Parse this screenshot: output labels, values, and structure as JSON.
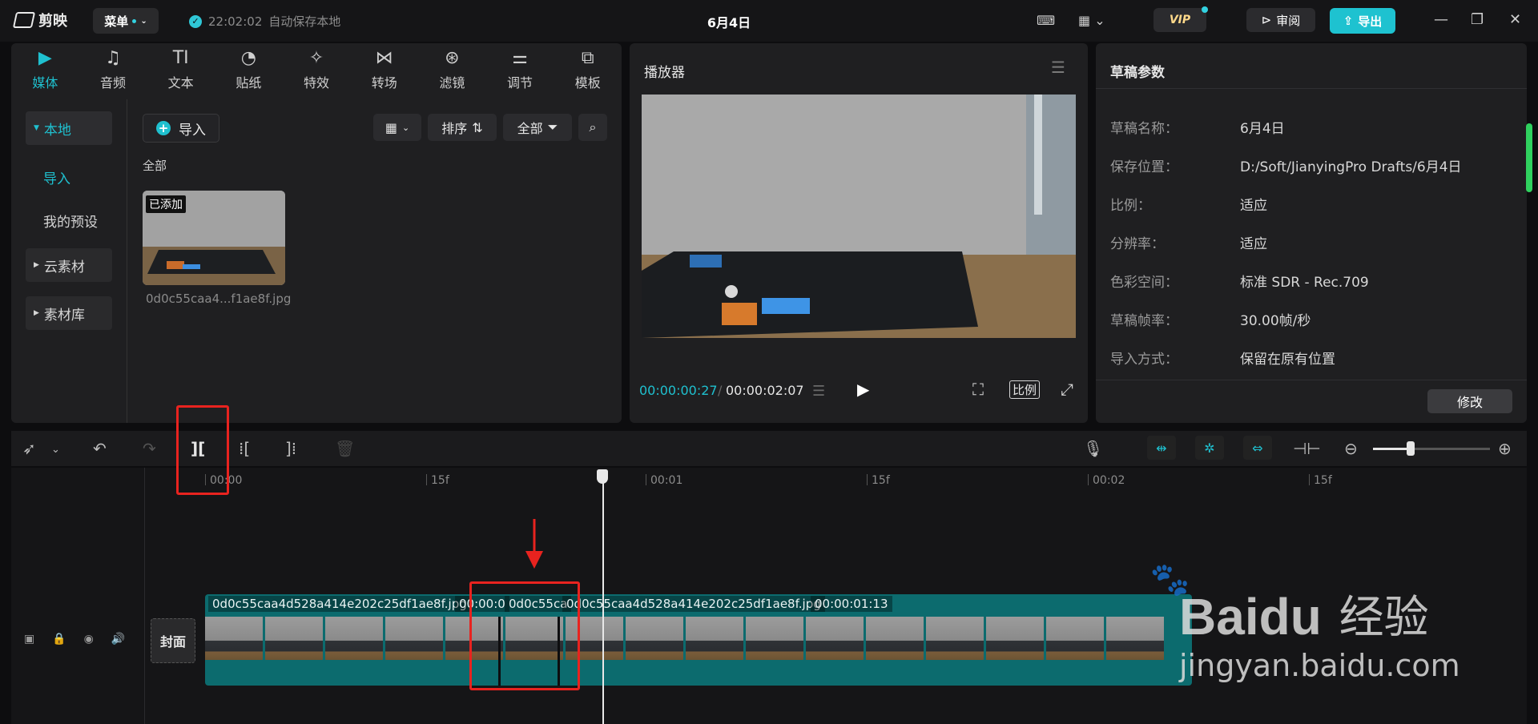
{
  "titlebar": {
    "app_name": "剪映",
    "menu_label": "菜单",
    "autosave_time": "22:02:02",
    "autosave_text": "自动保存本地",
    "doc_title": "6月4日",
    "vip_label": "VIP",
    "review_label": "审阅",
    "export_label": "导出"
  },
  "media_tabs": [
    {
      "label": "媒体",
      "icon": "▶"
    },
    {
      "label": "音频",
      "icon": "♫"
    },
    {
      "label": "文本",
      "icon": "TI"
    },
    {
      "label": "贴纸",
      "icon": "◔"
    },
    {
      "label": "特效",
      "icon": "✧"
    },
    {
      "label": "转场",
      "icon": "⋈"
    },
    {
      "label": "滤镜",
      "icon": "⊛"
    },
    {
      "label": "调节",
      "icon": "⚌"
    },
    {
      "label": "模板",
      "icon": "⧉"
    }
  ],
  "sidebar": {
    "local": "本地",
    "import": "导入",
    "my_presets": "我的预设",
    "cloud": "云素材",
    "library": "素材库"
  },
  "media": {
    "import_btn": "导入",
    "sort_label": "排序",
    "filter_label": "全部",
    "section_label": "全部",
    "added_badge": "已添加",
    "file_name": "0d0c55caa4...f1ae8f.jpg"
  },
  "player": {
    "title": "播放器",
    "current_time": "00:00:00:27",
    "total_time": "00:00:02:07",
    "ratio_label": "比例"
  },
  "draft": {
    "title": "草稿参数",
    "rows": [
      {
        "label": "草稿名称：",
        "value": "6月4日"
      },
      {
        "label": "保存位置：",
        "value": "D:/Soft/JianyingPro Drafts/6月4日"
      },
      {
        "label": "比例：",
        "value": "适应"
      },
      {
        "label": "分辨率：",
        "value": "适应"
      },
      {
        "label": "色彩空间：",
        "value": "标准 SDR - Rec.709"
      },
      {
        "label": "草稿帧率：",
        "value": "30.00帧/秒"
      },
      {
        "label": "导入方式：",
        "value": "保留在原有位置"
      }
    ],
    "modify_btn": "修改"
  },
  "timeline": {
    "ruler": [
      "00:00",
      "15f",
      "00:01",
      "15f",
      "00:02",
      "15f"
    ],
    "clip1_label": "0d0c55caa4d528a414e202c25df1ae8f.jpg",
    "clip1_time": "00:00:0",
    "clip2_label": "0d0c55ca",
    "clip3_label": "0d0c55caa4d528a414e202c25df1ae8f.jpg",
    "clip3_time": "00:00:01:13",
    "cover_label": "封面"
  },
  "watermark": {
    "brand": "Baidu",
    "cn": "经验",
    "url": "jingyan.baidu.com"
  }
}
